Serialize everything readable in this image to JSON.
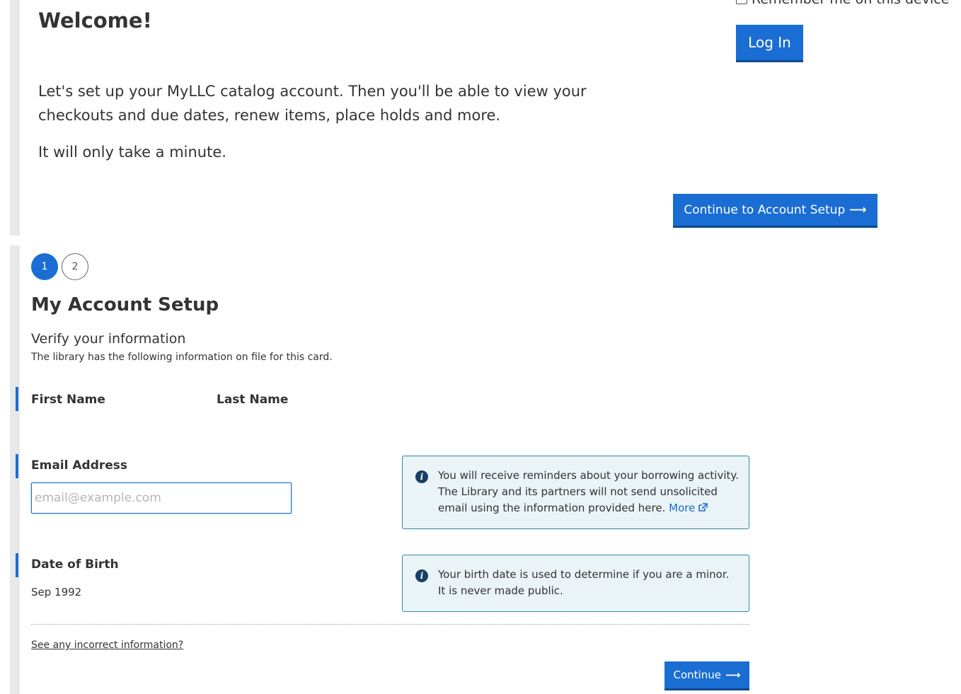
{
  "login": {
    "remember_label": "Remember me on this device",
    "login_button": "Log In"
  },
  "welcome": {
    "title": "Welcome!",
    "intro": "Let's set up your MyLLC catalog account. Then you'll be able to view your checkouts and due dates, renew items, place holds and more.",
    "minute": "It will only take a minute.",
    "continue_button": "Continue to Account Setup",
    "arrow": "⟶"
  },
  "setup": {
    "steps": [
      "1",
      "2"
    ],
    "current_step": 1,
    "title": "My Account Setup",
    "verify_heading": "Verify your information",
    "verify_sub": "The library has the following information on file for this card.",
    "first_name_label": "First Name",
    "last_name_label": "Last Name",
    "email_label": "Email Address",
    "email_placeholder": "email@example.com",
    "email_value": "",
    "email_info": "You will receive reminders about your borrowing activity. The Library and its partners will not send unsolicited email using the information provided here.",
    "email_info_more": "More",
    "dob_label": "Date of Birth",
    "dob_value": "Sep 1992",
    "dob_info": "Your birth date is used to determine if you are a minor. It is never made public.",
    "incorrect_link": "See any incorrect information?",
    "continue_button": "Continue",
    "arrow": "⟶"
  },
  "colors": {
    "primary": "#1a6dd2",
    "primary_dark": "#104a91",
    "info_bg": "#eaf3f5",
    "info_border": "#2a8aa4",
    "field_bar": "#1a6dd2"
  },
  "icons": {
    "info": "info-icon",
    "external_link": "external-link-icon",
    "arrow": "arrow-right-icon",
    "checkbox": "checkbox-icon"
  }
}
